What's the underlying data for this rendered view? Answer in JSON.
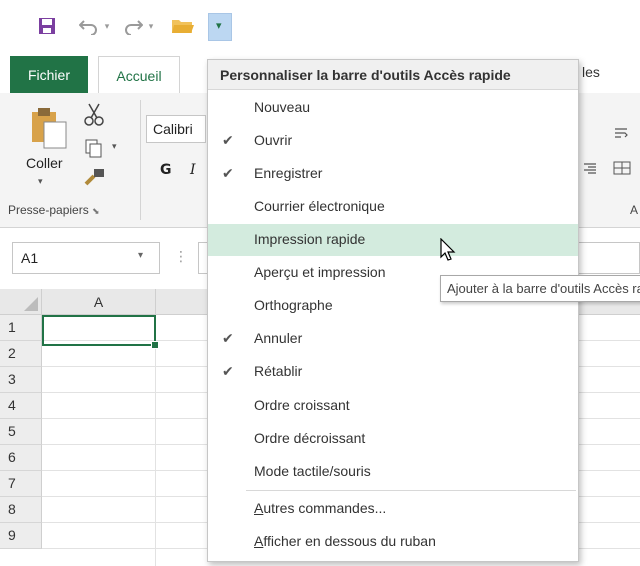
{
  "qat": {
    "icons": [
      "save-icon",
      "undo-icon",
      "redo-icon",
      "open-folder-icon",
      "customize-qat-icon"
    ],
    "customize_glyph": "▾"
  },
  "tabs": {
    "fichier": "Fichier",
    "accueil": "Accueil",
    "partial_right": "les"
  },
  "ribbon": {
    "paste_label": "Coller",
    "clipboard_group": "Presse-papiers",
    "font_name": "Calibri",
    "bold": "G",
    "italic": "I",
    "right_group_partial": "A"
  },
  "formula": {
    "name_box": "A1",
    "fx_dots": "⋮"
  },
  "grid": {
    "column_headers": [
      "A"
    ],
    "row_headers": [
      "1",
      "2",
      "3",
      "4",
      "5",
      "6",
      "7",
      "8",
      "9"
    ],
    "active_cell": "A1"
  },
  "menu": {
    "title": "Personnaliser la barre d'outils Accès rapide",
    "items": [
      {
        "label": "Nouveau",
        "checked": false
      },
      {
        "label": "Ouvrir",
        "checked": true
      },
      {
        "label": "Enregistrer",
        "checked": true
      },
      {
        "label": "Courrier électronique",
        "checked": false
      },
      {
        "label": "Impression rapide",
        "checked": false,
        "highlighted": true
      },
      {
        "label": "Aperçu et impression",
        "checked": false
      },
      {
        "label": "Orthographe",
        "checked": false
      },
      {
        "label": "Annuler",
        "checked": true
      },
      {
        "label": "Rétablir",
        "checked": true
      },
      {
        "label": "Ordre croissant",
        "checked": false
      },
      {
        "label": "Ordre décroissant",
        "checked": false
      },
      {
        "label": "Mode tactile/souris",
        "checked": false
      }
    ],
    "more_commands": {
      "mnemonic": "A",
      "rest": "utres commandes..."
    },
    "show_below": {
      "mnemonic": "A",
      "rest": "fficher en dessous du ruban"
    },
    "check_glyph": "✔"
  },
  "tooltip": {
    "text": "Ajouter à la barre d'outils Accès rapide"
  },
  "colors": {
    "excel_green": "#217346",
    "menu_highlight": "#d3ebde",
    "qat_customize_bg": "#bcd7f2"
  }
}
